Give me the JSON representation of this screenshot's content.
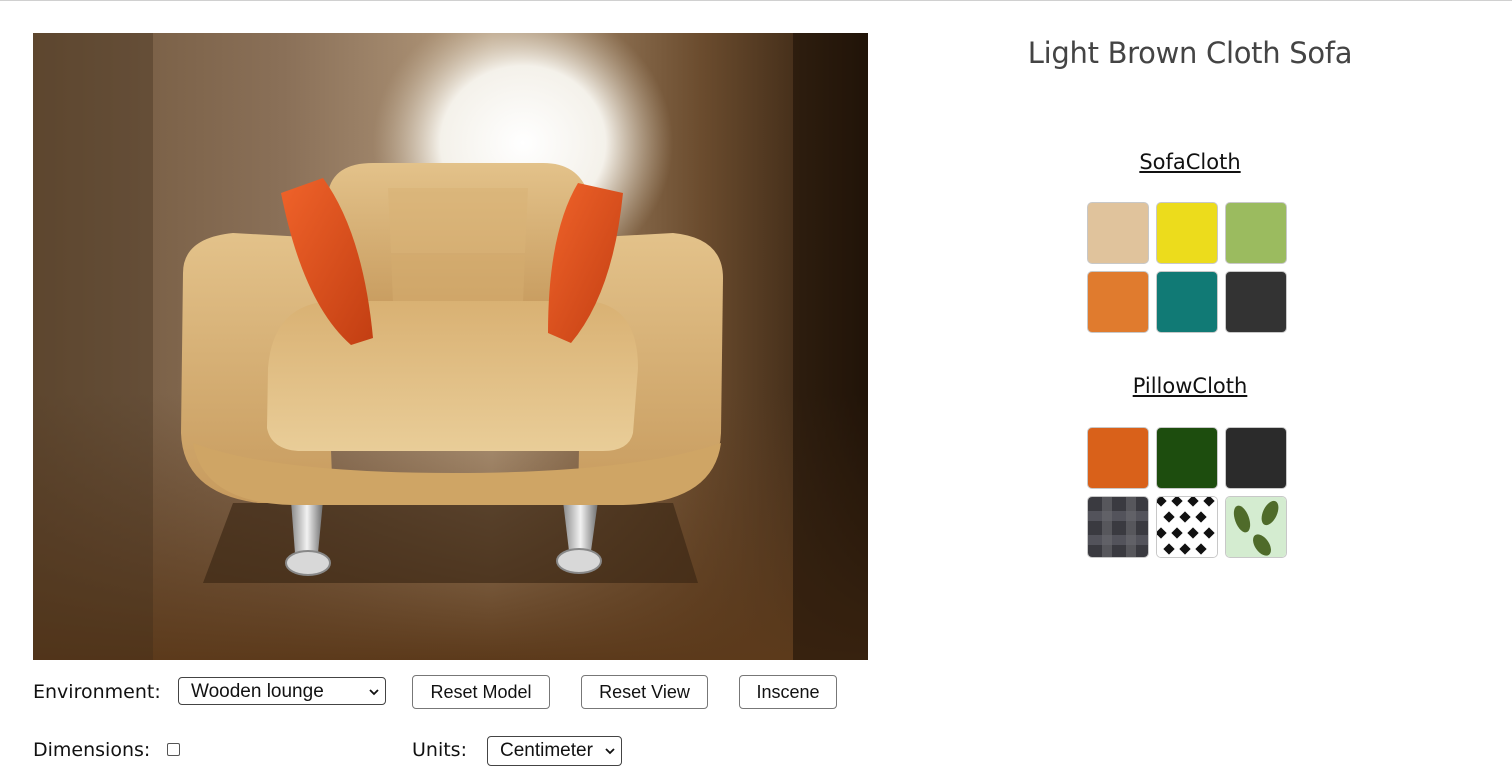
{
  "product": {
    "title": "Light Brown Cloth Sofa"
  },
  "controls": {
    "environment_label": "Environment:",
    "environment_value": "Wooden lounge",
    "reset_model": "Reset Model",
    "reset_view": "Reset View",
    "inscene": "Inscene",
    "dimensions_label": "Dimensions:",
    "dimensions_checked": false,
    "units_label": "Units:",
    "units_value": "Centimeter"
  },
  "sofa_cloth": {
    "title": "SofaCloth",
    "swatches": [
      {
        "name": "beige",
        "color": "#e0c39c"
      },
      {
        "name": "yellow",
        "color": "#ecdc1c"
      },
      {
        "name": "green",
        "color": "#9bbb5f"
      },
      {
        "name": "orange",
        "color": "#e07b2e"
      },
      {
        "name": "teal",
        "color": "#117a75"
      },
      {
        "name": "charcoal",
        "color": "#333333"
      }
    ]
  },
  "pillow_cloth": {
    "title": "PillowCloth",
    "swatches": [
      {
        "name": "orange",
        "color": "#d9611a"
      },
      {
        "name": "dark-green",
        "color": "#1d4d0e"
      },
      {
        "name": "charcoal",
        "color": "#2b2b2b"
      },
      {
        "name": "plaid-pattern",
        "color": "#3a3a40"
      },
      {
        "name": "checker-pattern",
        "color": "#ffffff"
      },
      {
        "name": "leaf-pattern",
        "color": "#d4ecd0"
      }
    ]
  }
}
